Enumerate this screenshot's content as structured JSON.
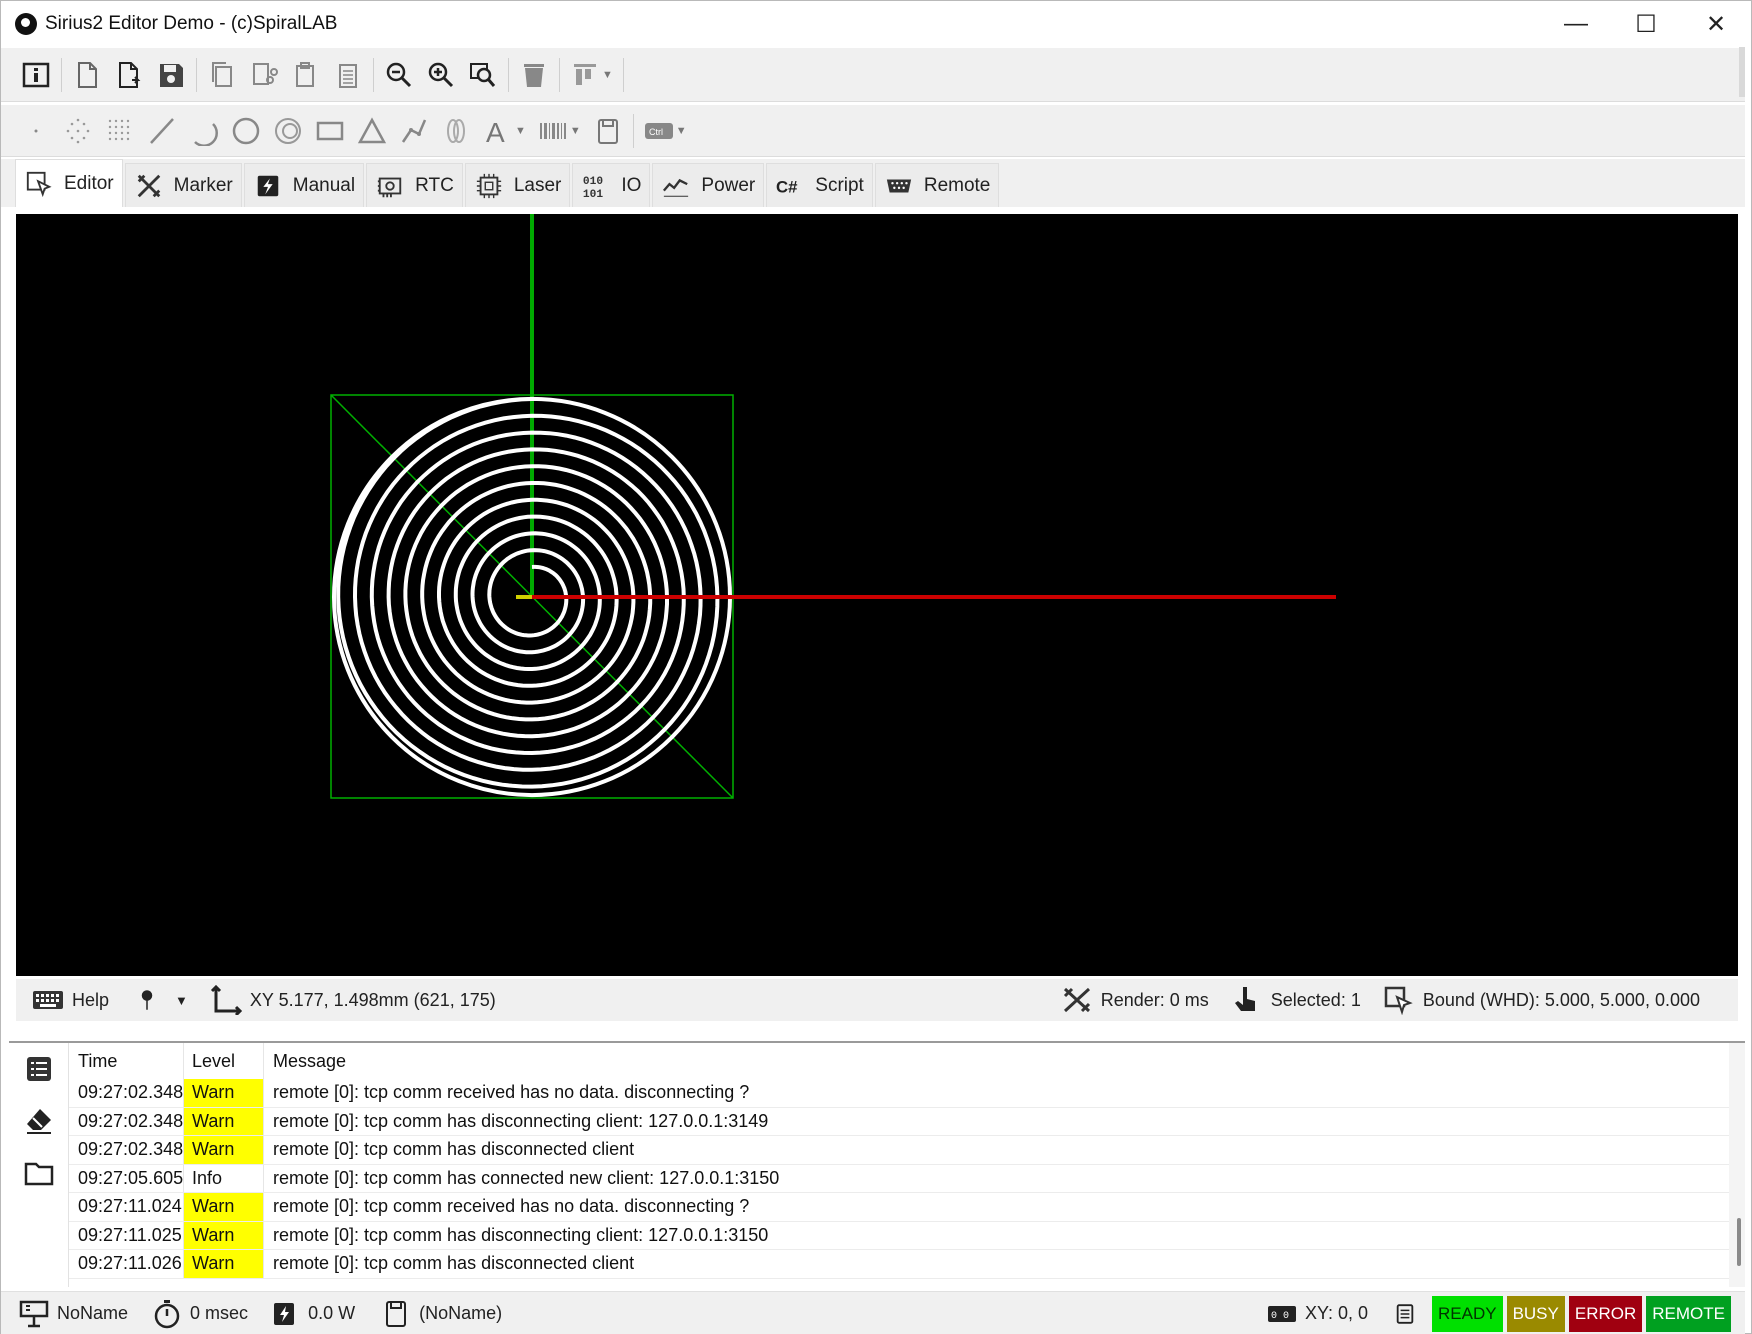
{
  "window": {
    "title": "Sirius2 Editor Demo - (c)SpiralLAB",
    "minimize_label": "—",
    "maximize_label": "☐",
    "close_label": "✕"
  },
  "toolbar1": {
    "icons": [
      "info-icon",
      "new-document-icon",
      "open-document-icon",
      "save-icon",
      "copy-icon",
      "cut-icon",
      "paste-icon",
      "paste-array-icon",
      "zoom-out-icon",
      "zoom-in-icon",
      "zoom-fit-icon",
      "delete-icon",
      "align-icon"
    ]
  },
  "toolbar2": {
    "icons": [
      "point-icon",
      "points-icon",
      "raster-icon",
      "line-icon",
      "arc-icon",
      "circle-icon",
      "spiral-icon",
      "rectangle-icon",
      "triangle-icon",
      "polyline-icon",
      "trepan-icon",
      "text-icon",
      "barcode-icon",
      "file-icon",
      "control-icon"
    ],
    "ctrl_label": "Ctrl"
  },
  "tabs": [
    {
      "label": "Editor",
      "icon": "editor-icon",
      "active": true
    },
    {
      "label": "Marker",
      "icon": "marker-icon",
      "active": false
    },
    {
      "label": "Manual",
      "icon": "manual-icon",
      "active": false
    },
    {
      "label": "RTC",
      "icon": "rtc-icon",
      "active": false
    },
    {
      "label": "Laser",
      "icon": "laser-icon",
      "active": false
    },
    {
      "label": "IO",
      "icon": "io-icon",
      "active": false
    },
    {
      "label": "Power",
      "icon": "power-icon",
      "active": false
    },
    {
      "label": "Script",
      "icon": "script-icon",
      "active": false
    },
    {
      "label": "Remote",
      "icon": "remote-icon",
      "active": false
    }
  ],
  "canvas": {
    "background": "#000000",
    "axis_x_color": "#cc0000",
    "axis_y_color": "#00aa00",
    "spiral_color": "#ffffff",
    "bound_color": "#00b000",
    "spiral_turns": 10
  },
  "editor_status": {
    "help_label": "Help",
    "coordinates": "XY 5.177, 1.498mm (621, 175)",
    "render": "Render: 0 ms",
    "selected": "Selected: 1",
    "bound": "Bound (WHD): 5.000, 5.000, 0.000"
  },
  "log": {
    "columns": {
      "time": "Time",
      "level": "Level",
      "message": "Message"
    },
    "rows": [
      {
        "time": "09:27:02.348",
        "level": "Warn",
        "message": "remote [0]: tcp comm received has no data. disconnecting ?"
      },
      {
        "time": "09:27:02.348",
        "level": "Warn",
        "message": "remote [0]: tcp comm has disconnecting client: 127.0.0.1:3149"
      },
      {
        "time": "09:27:02.348",
        "level": "Warn",
        "message": "remote [0]: tcp comm has disconnected client"
      },
      {
        "time": "09:27:05.605",
        "level": "Info",
        "message": "remote [0]: tcp comm has connected new client: 127.0.0.1:3150"
      },
      {
        "time": "09:27:11.024",
        "level": "Warn",
        "message": "remote [0]: tcp comm received has no data. disconnecting ?"
      },
      {
        "time": "09:27:11.025",
        "level": "Warn",
        "message": "remote [0]: tcp comm has disconnecting client: 127.0.0.1:3150"
      },
      {
        "time": "09:27:11.026",
        "level": "Warn",
        "message": "remote [0]: tcp comm has disconnected client"
      }
    ],
    "warn_color": "#ffff00"
  },
  "statusbar": {
    "document_name": "NoName",
    "time": "0 msec",
    "power": "0.0 W",
    "file": "(NoName)",
    "xy": "XY: 0, 0",
    "ready": "READY",
    "busy": "BUSY",
    "error": "ERROR",
    "remote": "REMOTE",
    "ready_color": "#00e000",
    "busy_color": "#9a8a00",
    "error_color": "#a00010",
    "remote_color": "#00a020"
  }
}
